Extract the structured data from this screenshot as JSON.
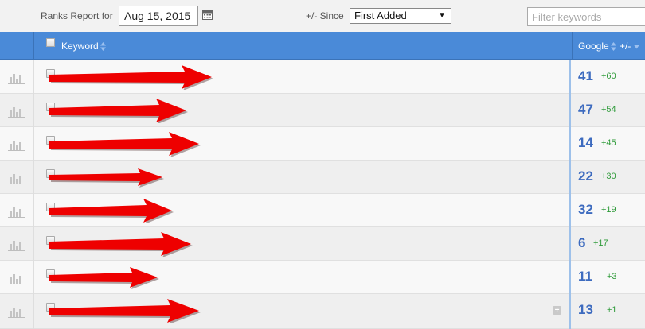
{
  "toolbar": {
    "ranks_report_label": "Ranks Report for",
    "date_value": "Aug 15, 2015",
    "since_label": "+/- Since",
    "since_selected": "First Added",
    "filter_placeholder": "Filter keywords"
  },
  "table": {
    "columns": {
      "keyword": "Keyword",
      "google": "Google",
      "change": "+/-"
    },
    "rows": [
      {
        "rank": "41",
        "change": "+60"
      },
      {
        "rank": "47",
        "change": "+54"
      },
      {
        "rank": "14",
        "change": "+45"
      },
      {
        "rank": "22",
        "change": "+30"
      },
      {
        "rank": "32",
        "change": "+19"
      },
      {
        "rank": "6",
        "change": "+17"
      },
      {
        "rank": "11",
        "change": "+3"
      },
      {
        "rank": "13",
        "change": "+1"
      }
    ]
  },
  "icons": {
    "calendar": "calendar-icon",
    "sort": "sort-icon",
    "row_chart": "bar-chart-icon",
    "expand": "plus-icon",
    "select_arrow": "caret-down-icon"
  },
  "colors": {
    "header_bg": "#4a8ad8",
    "rank_text": "#3d6bbf",
    "change_text": "#2f9b3a",
    "redaction": "#ee0000"
  }
}
